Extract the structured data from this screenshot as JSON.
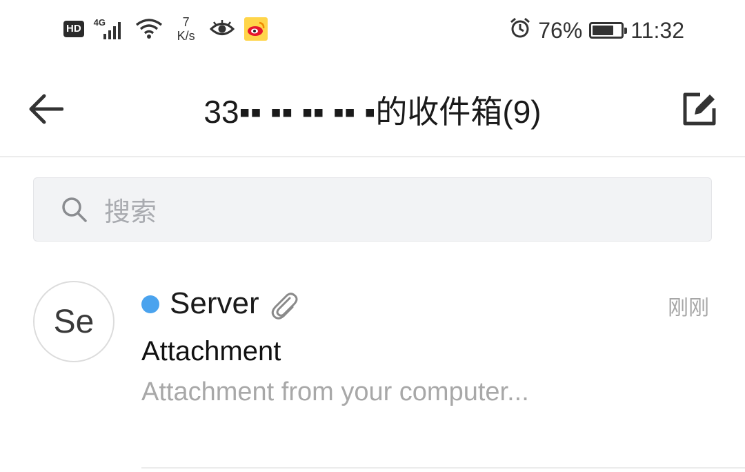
{
  "status_bar": {
    "hd": "HD",
    "network": "4G",
    "speed_value": "7",
    "speed_unit": "K/s",
    "battery_percent": "76%",
    "battery_level": 0.76,
    "time": "11:32",
    "icons": [
      "hd-icon",
      "signal-icon",
      "wifi-icon",
      "eye-icon",
      "weibo-icon",
      "alarm-icon",
      "battery-icon"
    ]
  },
  "header": {
    "title": "33▪▪ ▪▪ ▪▪ ▪▪ ▪的收件箱(9)",
    "back_icon": "arrow-left-icon",
    "compose_icon": "compose-icon"
  },
  "search": {
    "placeholder": "搜索",
    "icon": "search-icon"
  },
  "mail_list": [
    {
      "avatar_initials": "Se",
      "unread": true,
      "sender": "Server",
      "has_attachment": true,
      "time": "刚刚",
      "subject": "Attachment",
      "preview": "Attachment from your computer..."
    }
  ],
  "colors": {
    "unread_dot": "#4aa3ee",
    "text_primary": "#1a1a1a",
    "text_secondary": "#a8a8a8",
    "search_bg": "#f2f3f5"
  }
}
